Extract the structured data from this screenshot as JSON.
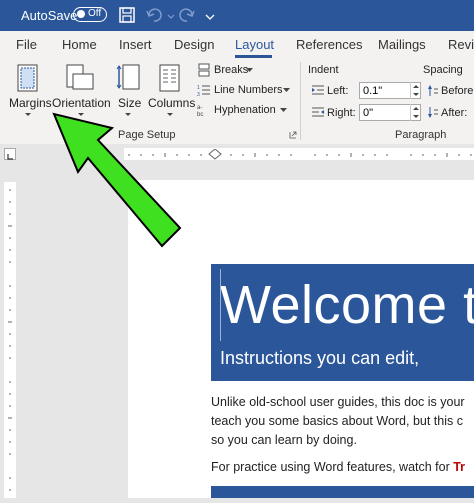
{
  "titlebar": {
    "autosave_label": "AutoSave",
    "toggle_state": "Off",
    "icons": [
      "save-icon",
      "undo-icon",
      "redo-icon",
      "customize-qat-icon"
    ]
  },
  "tabs": [
    {
      "label": "File"
    },
    {
      "label": "Home"
    },
    {
      "label": "Insert"
    },
    {
      "label": "Design"
    },
    {
      "label": "Layout",
      "active": true
    },
    {
      "label": "References"
    },
    {
      "label": "Mailings"
    },
    {
      "label": "Revie"
    }
  ],
  "ribbon": {
    "margins_label": "Margins",
    "orientation_label": "Orientation",
    "size_label": "Size",
    "columns_label": "Columns",
    "breaks_label": "Breaks",
    "line_numbers_label": "Line Numbers",
    "hyphenation_label": "Hyphenation",
    "page_setup_label": "Page Setup",
    "indent_label": "Indent",
    "left_label": "Left:",
    "left_value": "0.1\"",
    "right_label": "Right:",
    "right_value": "0\"",
    "spacing_label": "Spacing",
    "before_label": "Before",
    "after_label": "After:",
    "paragraph_label": "Paragraph"
  },
  "document": {
    "banner_title": "Welcome t",
    "banner_subtitle": "Instructions you can edit,",
    "lines": [
      "Unlike old-school user guides, this doc is your",
      "teach you some basics about Word, but this c",
      "so you can learn by doing."
    ],
    "practice_prefix": "For practice using Word features, watch for ",
    "practice_highlight": "Tr"
  },
  "colors": {
    "brand": "#2b579a",
    "arrow": "#3ee01f",
    "highlight_text": "#c00000"
  }
}
